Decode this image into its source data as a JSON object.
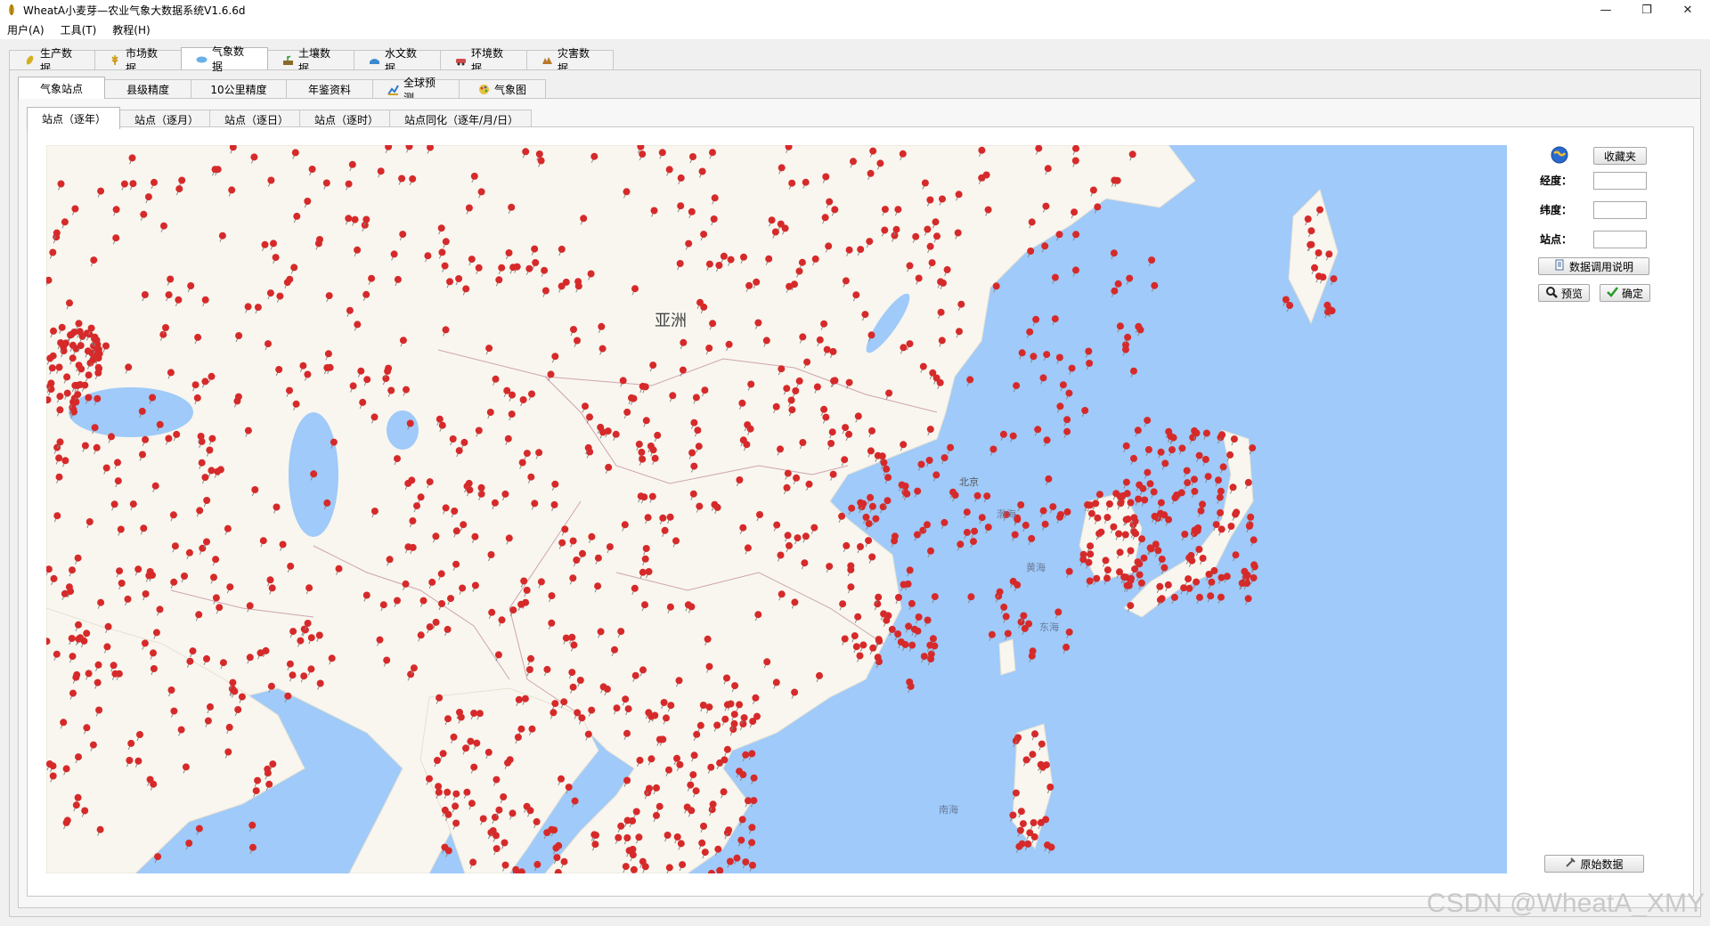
{
  "window": {
    "title": "WheatA小麦芽—农业气象大数据系统V1.6.6d",
    "controls": [
      "—",
      "❐",
      "✕"
    ]
  },
  "menu": [
    "用户(A)",
    "工具(T)",
    "教程(H)"
  ],
  "main_tabs": [
    {
      "label": "生产数据",
      "icon": "wheat-icon",
      "active": false
    },
    {
      "label": "市场数据",
      "icon": "grain-icon",
      "active": false
    },
    {
      "label": "气象数据",
      "icon": "cloud-icon",
      "active": true
    },
    {
      "label": "土壤数据",
      "icon": "soil-icon",
      "active": false
    },
    {
      "label": "水文数据",
      "icon": "water-icon",
      "active": false
    },
    {
      "label": "环境数据",
      "icon": "car-icon",
      "active": false
    },
    {
      "label": "灾害数据",
      "icon": "disaster-icon",
      "active": false
    }
  ],
  "sub_tabs": [
    {
      "label": "气象站点",
      "active": true
    },
    {
      "label": "县级精度",
      "active": false
    },
    {
      "label": "10公里精度",
      "active": false
    },
    {
      "label": "年鉴资料",
      "active": false
    },
    {
      "label": "全球预测",
      "icon": "chart-icon",
      "active": false
    },
    {
      "label": "气象图",
      "icon": "palette-icon",
      "active": false
    }
  ],
  "station_tabs": [
    {
      "label": "站点（逐年）",
      "active": true
    },
    {
      "label": "站点（逐月）",
      "active": false
    },
    {
      "label": "站点（逐日）",
      "active": false
    },
    {
      "label": "站点（逐时）",
      "active": false
    },
    {
      "label": "站点同化（逐年/月/日）",
      "active": false
    }
  ],
  "map": {
    "labels": {
      "continent": "亚洲",
      "beijing": "北京",
      "bohai": "渤海",
      "yellow_sea": "黄海",
      "east_sea": "东海",
      "south_sea": "南海"
    },
    "colors": {
      "sea": "#9fcaf9",
      "land": "#f8f6ef",
      "pin": "#d62a2a",
      "border": "#cfa3b0"
    }
  },
  "side": {
    "favorites_button": "收藏夹",
    "longitude_label": "经度：",
    "latitude_label": "纬度：",
    "station_label": "站点：",
    "longitude_value": "",
    "latitude_value": "",
    "station_value": "",
    "help_button": "数据调用说明",
    "preview_button": "预览",
    "confirm_button": "确定",
    "raw_data_button": "原始数据"
  },
  "watermark": "CSDN @WheatA_XMY"
}
